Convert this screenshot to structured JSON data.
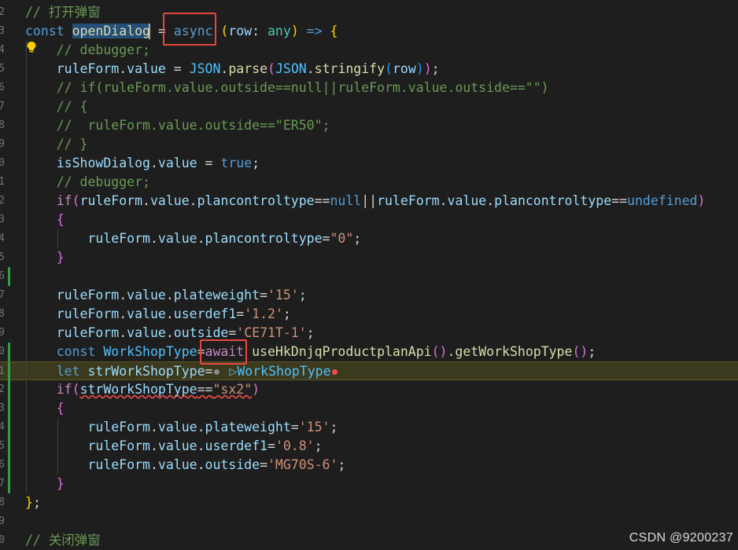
{
  "editor": {
    "line_numbers": [
      "2",
      "3",
      "4",
      "5",
      "6",
      "7",
      "8",
      "9",
      "0",
      "1",
      "2",
      "3",
      "4",
      "5",
      "6",
      "7",
      "8",
      "9",
      "0",
      "1",
      "2",
      "3",
      "4",
      "5",
      "6",
      "7",
      "8",
      "9",
      "0"
    ],
    "lines": [
      {
        "t": [
          [
            "cm",
            "// 打开弹窗"
          ]
        ]
      },
      {
        "t": [
          [
            "kw",
            "const "
          ],
          [
            "fn sel",
            "openDialog"
          ],
          [
            "pl",
            " = "
          ],
          [
            "kw",
            "async"
          ],
          [
            "pl",
            " "
          ],
          [
            "b1",
            "("
          ],
          [
            "vr",
            "row"
          ],
          [
            "pl",
            ": "
          ],
          [
            "ty",
            "any"
          ],
          [
            "b1",
            ")"
          ],
          [
            "pl",
            " "
          ],
          [
            "kw",
            "=>"
          ],
          [
            "pl",
            " "
          ],
          [
            "b1",
            "{"
          ]
        ]
      },
      {
        "t": [
          [
            "pl",
            "    "
          ],
          [
            "cm",
            "// debugger;"
          ]
        ]
      },
      {
        "t": [
          [
            "pl",
            "    "
          ],
          [
            "vr",
            "ruleForm"
          ],
          [
            "pl",
            "."
          ],
          [
            "vr",
            "value"
          ],
          [
            "pl",
            " = "
          ],
          [
            "cn",
            "JSON"
          ],
          [
            "pl",
            "."
          ],
          [
            "fn",
            "parse"
          ],
          [
            "b2",
            "("
          ],
          [
            "cn",
            "JSON"
          ],
          [
            "pl",
            "."
          ],
          [
            "fn",
            "stringify"
          ],
          [
            "b3",
            "("
          ],
          [
            "vr",
            "row"
          ],
          [
            "b3",
            ")"
          ],
          [
            "b2",
            ")"
          ],
          [
            "pl",
            ";"
          ]
        ]
      },
      {
        "t": [
          [
            "pl",
            "    "
          ],
          [
            "cm",
            "// if(ruleForm.value.outside==null||ruleForm.value.outside==\"\")"
          ]
        ]
      },
      {
        "t": [
          [
            "pl",
            "    "
          ],
          [
            "cm",
            "// {"
          ]
        ]
      },
      {
        "t": [
          [
            "pl",
            "    "
          ],
          [
            "cm",
            "//  ruleForm.value.outside==\"ER50\";"
          ]
        ]
      },
      {
        "t": [
          [
            "pl",
            "    "
          ],
          [
            "cm",
            "// }"
          ]
        ]
      },
      {
        "t": [
          [
            "pl",
            "    "
          ],
          [
            "vr",
            "isShowDialog"
          ],
          [
            "pl",
            "."
          ],
          [
            "vr",
            "value"
          ],
          [
            "pl",
            " = "
          ],
          [
            "kw",
            "true"
          ],
          [
            "pl",
            ";"
          ]
        ]
      },
      {
        "t": [
          [
            "pl",
            "    "
          ],
          [
            "cm",
            "// debugger;"
          ]
        ]
      },
      {
        "t": [
          [
            "pl",
            "    "
          ],
          [
            "ctl",
            "if"
          ],
          [
            "b2",
            "("
          ],
          [
            "vr",
            "ruleForm"
          ],
          [
            "pl",
            "."
          ],
          [
            "vr",
            "value"
          ],
          [
            "pl",
            "."
          ],
          [
            "vr",
            "plancontroltype"
          ],
          [
            "pl",
            "=="
          ],
          [
            "kw",
            "null"
          ],
          [
            "pl",
            "||"
          ],
          [
            "vr",
            "ruleForm"
          ],
          [
            "pl",
            "."
          ],
          [
            "vr",
            "value"
          ],
          [
            "pl",
            "."
          ],
          [
            "vr",
            "plancontroltype"
          ],
          [
            "pl",
            "=="
          ],
          [
            "kw",
            "undefined"
          ],
          [
            "b2",
            ")"
          ]
        ]
      },
      {
        "t": [
          [
            "pl",
            "    "
          ],
          [
            "b2",
            "{"
          ]
        ]
      },
      {
        "t": [
          [
            "pl",
            "        "
          ],
          [
            "vr",
            "ruleForm"
          ],
          [
            "pl",
            "."
          ],
          [
            "vr",
            "value"
          ],
          [
            "pl",
            "."
          ],
          [
            "vr",
            "plancontroltype"
          ],
          [
            "pl",
            "="
          ],
          [
            "st",
            "\"0\""
          ],
          [
            "pl",
            ";"
          ]
        ]
      },
      {
        "t": [
          [
            "pl",
            "    "
          ],
          [
            "b2",
            "}"
          ]
        ]
      },
      {
        "t": []
      },
      {
        "t": [
          [
            "pl",
            "    "
          ],
          [
            "vr",
            "ruleForm"
          ],
          [
            "pl",
            "."
          ],
          [
            "vr",
            "value"
          ],
          [
            "pl",
            "."
          ],
          [
            "vr",
            "plateweight"
          ],
          [
            "pl",
            "="
          ],
          [
            "st",
            "'15'"
          ],
          [
            "pl",
            ";"
          ]
        ]
      },
      {
        "t": [
          [
            "pl",
            "    "
          ],
          [
            "vr",
            "ruleForm"
          ],
          [
            "pl",
            "."
          ],
          [
            "vr",
            "value"
          ],
          [
            "pl",
            "."
          ],
          [
            "vr",
            "userdef1"
          ],
          [
            "pl",
            "="
          ],
          [
            "st",
            "'1.2'"
          ],
          [
            "pl",
            ";"
          ]
        ]
      },
      {
        "t": [
          [
            "pl",
            "    "
          ],
          [
            "vr",
            "ruleForm"
          ],
          [
            "pl",
            "."
          ],
          [
            "vr",
            "value"
          ],
          [
            "pl",
            "."
          ],
          [
            "vr",
            "outside"
          ],
          [
            "pl",
            "="
          ],
          [
            "st",
            "'CE71T-1'"
          ],
          [
            "pl",
            ";"
          ]
        ]
      },
      {
        "t": [
          [
            "pl",
            "    "
          ],
          [
            "kw",
            "const "
          ],
          [
            "cn",
            "WorkShopType"
          ],
          [
            "pl",
            "="
          ],
          [
            "ctl",
            "await"
          ],
          [
            "pl",
            " "
          ],
          [
            "fn",
            "useHkDnjqProductplanApi"
          ],
          [
            "b2",
            "()"
          ],
          [
            "pl",
            "."
          ],
          [
            "fn",
            "getWorkShopType"
          ],
          [
            "b2",
            "()"
          ],
          [
            "pl",
            ";"
          ]
        ]
      },
      {
        "t": [
          [
            "pl",
            "    "
          ],
          [
            "kw",
            "let "
          ],
          [
            "vr",
            "strWorkShopType"
          ],
          [
            "pl",
            "="
          ],
          [
            "dot",
            ""
          ],
          [
            "pl",
            " "
          ],
          [
            "inlay",
            "▷"
          ],
          [
            "cn",
            "WorkShopType"
          ],
          [
            "red",
            ""
          ]
        ]
      },
      {
        "t": [
          [
            "pl",
            "    "
          ],
          [
            "ctl",
            "if"
          ],
          [
            "b2",
            "("
          ],
          [
            "vr squiggle",
            "strWorkShopType"
          ],
          [
            "pl squiggle",
            "=="
          ],
          [
            "st squiggle",
            "\"sx2\""
          ],
          [
            "b2",
            ")"
          ]
        ]
      },
      {
        "t": [
          [
            "pl",
            "    "
          ],
          [
            "b2",
            "{"
          ]
        ]
      },
      {
        "t": [
          [
            "pl",
            "        "
          ],
          [
            "vr",
            "ruleForm"
          ],
          [
            "pl",
            "."
          ],
          [
            "vr",
            "value"
          ],
          [
            "pl",
            "."
          ],
          [
            "vr",
            "plateweight"
          ],
          [
            "pl",
            "="
          ],
          [
            "st",
            "'15'"
          ],
          [
            "pl",
            ";"
          ]
        ]
      },
      {
        "t": [
          [
            "pl",
            "        "
          ],
          [
            "vr",
            "ruleForm"
          ],
          [
            "pl",
            "."
          ],
          [
            "vr",
            "value"
          ],
          [
            "pl",
            "."
          ],
          [
            "vr",
            "userdef1"
          ],
          [
            "pl",
            "="
          ],
          [
            "st",
            "'0.8'"
          ],
          [
            "pl",
            ";"
          ]
        ]
      },
      {
        "t": [
          [
            "pl",
            "        "
          ],
          [
            "vr",
            "ruleForm"
          ],
          [
            "pl",
            "."
          ],
          [
            "vr",
            "value"
          ],
          [
            "pl",
            "."
          ],
          [
            "vr",
            "outside"
          ],
          [
            "pl",
            "="
          ],
          [
            "st",
            "'MG70S-6'"
          ],
          [
            "pl",
            ";"
          ]
        ]
      },
      {
        "t": [
          [
            "pl",
            "    "
          ],
          [
            "b2",
            "}"
          ]
        ]
      },
      {
        "t": [
          [
            "b1",
            "}"
          ],
          [
            "pl",
            ";"
          ]
        ]
      },
      {
        "t": []
      },
      {
        "t": [
          [
            "cm",
            "// 关闭弹窗"
          ]
        ]
      }
    ],
    "highlighted_line": 19,
    "colors": {
      "annotation_box": "#e8473f",
      "background": "#1e1e1e"
    }
  },
  "watermark": "CSDN @9200237"
}
